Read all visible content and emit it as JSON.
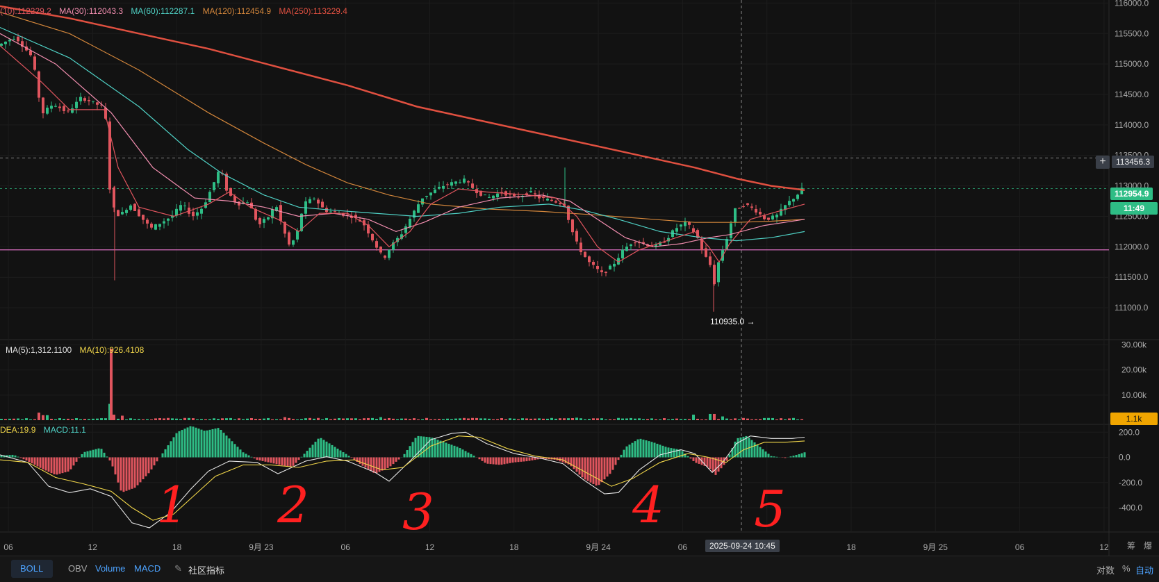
{
  "legend": {
    "ma10": "(10):112229.2",
    "ma30": "MA(30):112043.3",
    "ma60": "MA(60):112287.1",
    "ma120": "MA(120):112454.9",
    "ma250": "MA(250):113229.4",
    "vol_ma5": "MA(5):1,312.1100",
    "vol_ma10": "MA(10):926.4108",
    "dea": "DEA:19.9",
    "macd": "MACD:11.1"
  },
  "colors": {
    "up": "#2ebd85",
    "down": "#e0555e",
    "ma10": "#e0555e",
    "ma30": "#f48fb1",
    "ma60": "#4fd1c5",
    "ma120": "#d3863b",
    "ma250": "#e05040",
    "accent": "#2ebd85",
    "vol_badge": "#f0a500"
  },
  "chart_data": {
    "type": "candlestick",
    "price_axis": [
      "116000.0",
      "115500.0",
      "115000.0",
      "114500.0",
      "114000.0",
      "113500.0",
      "113000.0",
      "112500.0",
      "112000.0",
      "111500.0",
      "111000.0"
    ],
    "price_range": [
      110750,
      116050
    ],
    "crosshair_price": "113456.3",
    "last_price": "112954.9",
    "countdown": "11:49",
    "low_marker": "110935.0 →",
    "low_value": 110935,
    "horizontal_line_price": 111950,
    "volume_axis": [
      "30.00k",
      "20.00k",
      "10.00k"
    ],
    "volume_range": [
      0,
      31000
    ],
    "volume_badge": "1.1k",
    "macd_axis": [
      "200.0",
      "0.0",
      "-200.0",
      "-400.0"
    ],
    "macd_range": [
      -560,
      240
    ],
    "time_axis": [
      "06",
      "12",
      "18",
      "9月 23",
      "06",
      "12",
      "18",
      "9月 24",
      "06",
      "12",
      "18",
      "9月 25",
      "06",
      "12"
    ],
    "crosshair_time": "2025-09-24 10:45",
    "axis_corner": [
      "筹",
      "爆"
    ],
    "price_path": [
      [
        0,
        115300
      ],
      [
        25,
        115450
      ],
      [
        50,
        115100
      ],
      [
        58,
        114500
      ],
      [
        65,
        114200
      ],
      [
        80,
        114350
      ],
      [
        100,
        114200
      ],
      [
        120,
        114450
      ],
      [
        150,
        114300
      ],
      [
        157,
        114000
      ],
      [
        162,
        112700
      ],
      [
        175,
        112500
      ],
      [
        190,
        112700
      ],
      [
        205,
        112500
      ],
      [
        220,
        112300
      ],
      [
        235,
        112400
      ],
      [
        250,
        112500
      ],
      [
        265,
        112700
      ],
      [
        280,
        112500
      ],
      [
        295,
        112650
      ],
      [
        305,
        112900
      ],
      [
        320,
        113300
      ],
      [
        330,
        112900
      ],
      [
        345,
        112700
      ],
      [
        360,
        112750
      ],
      [
        375,
        112350
      ],
      [
        390,
        112500
      ],
      [
        400,
        112700
      ],
      [
        410,
        112300
      ],
      [
        420,
        112000
      ],
      [
        430,
        112200
      ],
      [
        440,
        112700
      ],
      [
        455,
        112800
      ],
      [
        470,
        112600
      ],
      [
        490,
        112550
      ],
      [
        510,
        112500
      ],
      [
        525,
        112400
      ],
      [
        540,
        112100
      ],
      [
        555,
        111800
      ],
      [
        565,
        112000
      ],
      [
        580,
        112200
      ],
      [
        595,
        112500
      ],
      [
        610,
        112800
      ],
      [
        625,
        112900
      ],
      [
        640,
        113000
      ],
      [
        655,
        113050
      ],
      [
        670,
        113100
      ],
      [
        690,
        112900
      ],
      [
        705,
        112800
      ],
      [
        725,
        112900
      ],
      [
        745,
        112800
      ],
      [
        765,
        112900
      ],
      [
        780,
        112800
      ],
      [
        800,
        112750
      ],
      [
        815,
        112700
      ],
      [
        825,
        112300
      ],
      [
        835,
        112000
      ],
      [
        850,
        111750
      ],
      [
        870,
        111550
      ],
      [
        885,
        111700
      ],
      [
        900,
        111950
      ],
      [
        915,
        112100
      ],
      [
        930,
        112050
      ],
      [
        945,
        112000
      ],
      [
        960,
        112100
      ],
      [
        975,
        112300
      ],
      [
        990,
        112400
      ],
      [
        1005,
        112200
      ],
      [
        1015,
        111900
      ],
      [
        1025,
        111700
      ],
      [
        1030,
        111350
      ],
      [
        1038,
        111800
      ],
      [
        1048,
        112100
      ],
      [
        1060,
        112600
      ],
      [
        1075,
        112700
      ],
      [
        1090,
        112600
      ],
      [
        1105,
        112450
      ],
      [
        1120,
        112500
      ],
      [
        1135,
        112700
      ],
      [
        1150,
        112850
      ],
      [
        1158,
        112955
      ]
    ],
    "ma_lines": {
      "ma10": [
        [
          0,
          115300
        ],
        [
          60,
          114700
        ],
        [
          100,
          114250
        ],
        [
          150,
          114250
        ],
        [
          170,
          113300
        ],
        [
          200,
          112650
        ],
        [
          250,
          112500
        ],
        [
          300,
          112700
        ],
        [
          330,
          112900
        ],
        [
          360,
          112650
        ],
        [
          400,
          112450
        ],
        [
          430,
          112250
        ],
        [
          460,
          112550
        ],
        [
          500,
          112550
        ],
        [
          530,
          112350
        ],
        [
          560,
          112000
        ],
        [
          590,
          112250
        ],
        [
          620,
          112700
        ],
        [
          660,
          112950
        ],
        [
          700,
          112900
        ],
        [
          760,
          112850
        ],
        [
          800,
          112800
        ],
        [
          830,
          112500
        ],
        [
          860,
          112000
        ],
        [
          890,
          111750
        ],
        [
          920,
          111950
        ],
        [
          960,
          112100
        ],
        [
          1000,
          112250
        ],
        [
          1020,
          112000
        ],
        [
          1035,
          111750
        ],
        [
          1050,
          112050
        ],
        [
          1080,
          112450
        ],
        [
          1110,
          112550
        ],
        [
          1158,
          112700
        ]
      ],
      "ma30": [
        [
          0,
          115500
        ],
        [
          80,
          115000
        ],
        [
          160,
          114200
        ],
        [
          220,
          113300
        ],
        [
          280,
          112800
        ],
        [
          330,
          112750
        ],
        [
          380,
          112650
        ],
        [
          430,
          112500
        ],
        [
          480,
          112550
        ],
        [
          530,
          112450
        ],
        [
          570,
          112250
        ],
        [
          610,
          112400
        ],
        [
          660,
          112650
        ],
        [
          720,
          112800
        ],
        [
          780,
          112850
        ],
        [
          820,
          112750
        ],
        [
          860,
          112450
        ],
        [
          900,
          112150
        ],
        [
          940,
          112000
        ],
        [
          980,
          112050
        ],
        [
          1020,
          112150
        ],
        [
          1050,
          112200
        ],
        [
          1100,
          112350
        ],
        [
          1158,
          112450
        ]
      ],
      "ma60": [
        [
          0,
          115600
        ],
        [
          100,
          115100
        ],
        [
          200,
          114300
        ],
        [
          270,
          113600
        ],
        [
          320,
          113200
        ],
        [
          380,
          112850
        ],
        [
          430,
          112650
        ],
        [
          480,
          112600
        ],
        [
          540,
          112550
        ],
        [
          600,
          112500
        ],
        [
          660,
          112550
        ],
        [
          720,
          112650
        ],
        [
          790,
          112700
        ],
        [
          840,
          112600
        ],
        [
          890,
          112450
        ],
        [
          950,
          112250
        ],
        [
          1010,
          112150
        ],
        [
          1060,
          112100
        ],
        [
          1110,
          112150
        ],
        [
          1158,
          112250
        ]
      ],
      "ma120": [
        [
          0,
          115850
        ],
        [
          100,
          115500
        ],
        [
          200,
          114900
        ],
        [
          300,
          114200
        ],
        [
          380,
          113700
        ],
        [
          440,
          113350
        ],
        [
          500,
          113050
        ],
        [
          560,
          112850
        ],
        [
          620,
          112700
        ],
        [
          700,
          112620
        ],
        [
          780,
          112580
        ],
        [
          860,
          112520
        ],
        [
          940,
          112450
        ],
        [
          1000,
          112400
        ],
        [
          1060,
          112400
        ],
        [
          1110,
          112420
        ],
        [
          1158,
          112450
        ]
      ],
      "ma250": [
        [
          0,
          115950
        ],
        [
          100,
          115750
        ],
        [
          200,
          115500
        ],
        [
          300,
          115250
        ],
        [
          400,
          114950
        ],
        [
          500,
          114650
        ],
        [
          600,
          114300
        ],
        [
          700,
          114050
        ],
        [
          800,
          113800
        ],
        [
          900,
          113550
        ],
        [
          1000,
          113300
        ],
        [
          1060,
          113120
        ],
        [
          1110,
          113000
        ],
        [
          1158,
          112930
        ]
      ]
    },
    "volume_spikes": [
      [
        58,
        3000
      ],
      [
        65,
        2000
      ],
      [
        160,
        6500
      ],
      [
        165,
        2200
      ],
      [
        175,
        1800
      ],
      [
        410,
        1200
      ],
      [
        550,
        1200
      ],
      [
        830,
        1000
      ],
      [
        1000,
        2200
      ],
      [
        1025,
        2500
      ],
      [
        1040,
        1500
      ]
    ],
    "macd_hist": [
      [
        0,
        15
      ],
      [
        20,
        20
      ],
      [
        40,
        -30
      ],
      [
        60,
        -90
      ],
      [
        80,
        -140
      ],
      [
        100,
        -110
      ],
      [
        120,
        40
      ],
      [
        145,
        75
      ],
      [
        160,
        -40
      ],
      [
        175,
        -280
      ],
      [
        195,
        -240
      ],
      [
        215,
        -120
      ],
      [
        235,
        40
      ],
      [
        255,
        200
      ],
      [
        275,
        250
      ],
      [
        295,
        210
      ],
      [
        315,
        235
      ],
      [
        330,
        150
      ],
      [
        350,
        40
      ],
      [
        370,
        -20
      ],
      [
        395,
        -50
      ],
      [
        420,
        -80
      ],
      [
        440,
        40
      ],
      [
        460,
        160
      ],
      [
        480,
        90
      ],
      [
        500,
        20
      ],
      [
        520,
        -60
      ],
      [
        540,
        -130
      ],
      [
        560,
        -80
      ],
      [
        580,
        10
      ],
      [
        600,
        170
      ],
      [
        620,
        160
      ],
      [
        640,
        120
      ],
      [
        660,
        80
      ],
      [
        680,
        20
      ],
      [
        700,
        -50
      ],
      [
        720,
        -60
      ],
      [
        740,
        -40
      ],
      [
        760,
        -30
      ],
      [
        780,
        -10
      ],
      [
        800,
        -20
      ],
      [
        820,
        -60
      ],
      [
        840,
        -170
      ],
      [
        860,
        -230
      ],
      [
        880,
        -120
      ],
      [
        900,
        80
      ],
      [
        920,
        150
      ],
      [
        940,
        120
      ],
      [
        960,
        80
      ],
      [
        980,
        60
      ],
      [
        1000,
        -40
      ],
      [
        1020,
        -80
      ],
      [
        1030,
        -140
      ],
      [
        1045,
        -40
      ],
      [
        1060,
        150
      ],
      [
        1075,
        170
      ],
      [
        1090,
        100
      ],
      [
        1110,
        10
      ],
      [
        1130,
        -5
      ],
      [
        1150,
        25
      ],
      [
        1158,
        40
      ]
    ],
    "macd_dif": [
      [
        0,
        20
      ],
      [
        40,
        -40
      ],
      [
        70,
        -230
      ],
      [
        100,
        -280
      ],
      [
        130,
        -250
      ],
      [
        160,
        -310
      ],
      [
        190,
        -520
      ],
      [
        215,
        -560
      ],
      [
        245,
        -440
      ],
      [
        275,
        -250
      ],
      [
        300,
        -110
      ],
      [
        330,
        -30
      ],
      [
        370,
        -40
      ],
      [
        400,
        -130
      ],
      [
        440,
        -30
      ],
      [
        470,
        5
      ],
      [
        500,
        -30
      ],
      [
        540,
        -120
      ],
      [
        560,
        -190
      ],
      [
        590,
        -30
      ],
      [
        620,
        140
      ],
      [
        650,
        190
      ],
      [
        670,
        200
      ],
      [
        700,
        110
      ],
      [
        740,
        30
      ],
      [
        780,
        -10
      ],
      [
        810,
        -50
      ],
      [
        840,
        -180
      ],
      [
        870,
        -290
      ],
      [
        890,
        -280
      ],
      [
        920,
        -100
      ],
      [
        950,
        20
      ],
      [
        980,
        60
      ],
      [
        1000,
        30
      ],
      [
        1025,
        -120
      ],
      [
        1040,
        -40
      ],
      [
        1060,
        110
      ],
      [
        1080,
        170
      ],
      [
        1110,
        150
      ],
      [
        1140,
        150
      ],
      [
        1158,
        160
      ]
    ],
    "macd_dea": [
      [
        0,
        -20
      ],
      [
        40,
        -40
      ],
      [
        80,
        -160
      ],
      [
        120,
        -210
      ],
      [
        160,
        -270
      ],
      [
        190,
        -400
      ],
      [
        220,
        -500
      ],
      [
        250,
        -450
      ],
      [
        280,
        -300
      ],
      [
        310,
        -150
      ],
      [
        350,
        -60
      ],
      [
        390,
        -60
      ],
      [
        430,
        -80
      ],
      [
        470,
        -30
      ],
      [
        510,
        -20
      ],
      [
        550,
        -100
      ],
      [
        580,
        -80
      ],
      [
        620,
        90
      ],
      [
        660,
        170
      ],
      [
        690,
        160
      ],
      [
        730,
        70
      ],
      [
        770,
        10
      ],
      [
        810,
        -20
      ],
      [
        850,
        -140
      ],
      [
        880,
        -230
      ],
      [
        910,
        -170
      ],
      [
        950,
        -40
      ],
      [
        990,
        30
      ],
      [
        1020,
        0
      ],
      [
        1045,
        -40
      ],
      [
        1070,
        60
      ],
      [
        1100,
        120
      ],
      [
        1130,
        120
      ],
      [
        1158,
        130
      ]
    ],
    "annotations": [
      "1",
      "2",
      "3",
      "4",
      "5"
    ]
  },
  "bottom_bar": {
    "boll": "BOLL",
    "obv": "OBV",
    "volume": "Volume",
    "macd": "MACD",
    "community": "社区指标",
    "log": "对数",
    "percent": "%",
    "auto": "自动"
  }
}
